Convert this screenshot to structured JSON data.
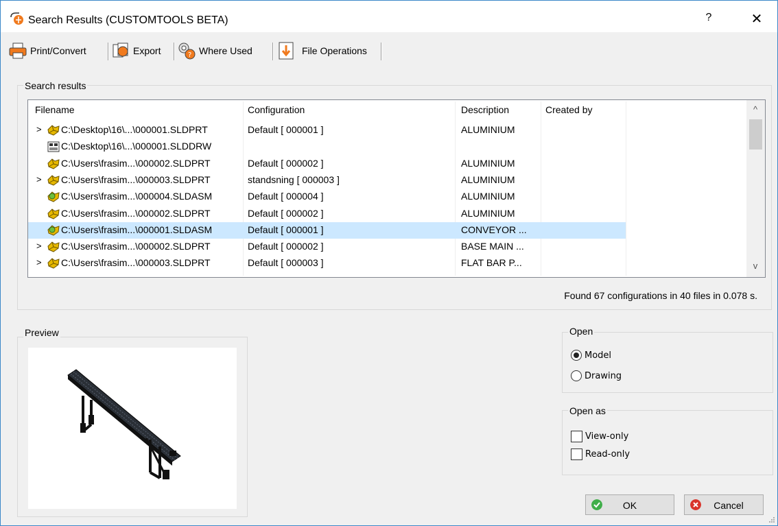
{
  "window": {
    "title": "Search Results (CUSTOMTOOLS BETA)",
    "help_label": "?",
    "close_label": "✕"
  },
  "toolbar": {
    "print_label": "Print/Convert",
    "export_label": "Export",
    "where_used_label": "Where Used",
    "file_ops_label": "File Operations"
  },
  "search": {
    "group_label": "Search results",
    "columns": [
      "Filename",
      "Configuration",
      "Description",
      "Created by"
    ],
    "rows": [
      {
        "expander": ">",
        "icon": "part-icon",
        "filename": "C:\\Desktop\\16\\...\\000001.SLDPRT",
        "configuration": "Default [ 000001 ]",
        "description": "ALUMINIUM",
        "created_by": ""
      },
      {
        "expander": "",
        "icon": "drawing-icon",
        "filename": "C:\\Desktop\\16\\...\\000001.SLDDRW",
        "configuration": "",
        "description": "",
        "created_by": ""
      },
      {
        "expander": "",
        "icon": "part-icon",
        "filename": "C:\\Users\\frasim...\\000002.SLDPRT",
        "configuration": "Default [ 000002 ]",
        "description": "ALUMINIUM",
        "created_by": ""
      },
      {
        "expander": ">",
        "icon": "part-icon",
        "filename": "C:\\Users\\frasim...\\000003.SLDPRT",
        "configuration": "standsning [ 000003 ]",
        "description": "ALUMINIUM",
        "created_by": ""
      },
      {
        "expander": "",
        "icon": "assembly-icon",
        "filename": "C:\\Users\\frasim...\\000004.SLDASM",
        "configuration": "Default [ 000004 ]",
        "description": "ALUMINIUM",
        "created_by": ""
      },
      {
        "expander": "",
        "icon": "part-icon",
        "filename": "C:\\Users\\frasim...\\000002.SLDPRT",
        "configuration": "Default [ 000002 ]",
        "description": "ALUMINIUM",
        "created_by": ""
      },
      {
        "expander": "",
        "icon": "assembly-icon",
        "filename": "C:\\Users\\frasim...\\000001.SLDASM",
        "configuration": "Default [ 000001 ]",
        "description": "CONVEYOR ...",
        "created_by": "",
        "selected": true
      },
      {
        "expander": ">",
        "icon": "part-icon",
        "filename": "C:\\Users\\frasim...\\000002.SLDPRT",
        "configuration": "Default [ 000002 ]",
        "description": "BASE MAIN ...",
        "created_by": ""
      },
      {
        "expander": ">",
        "icon": "part-icon",
        "filename": "C:\\Users\\frasim...\\000003.SLDPRT",
        "configuration": "Default [ 000003 ]",
        "description": "FLAT BAR P...",
        "created_by": ""
      }
    ],
    "status": "Found 67 configurations in 40 files in 0.078 s."
  },
  "preview": {
    "group_label": "Preview"
  },
  "open": {
    "group_label": "Open",
    "options": [
      "Model",
      "Drawing"
    ],
    "selected": "Model"
  },
  "open_as": {
    "group_label": "Open as",
    "options": [
      "View-only",
      "Read-only"
    ]
  },
  "buttons": {
    "ok_label": "OK",
    "cancel_label": "Cancel"
  },
  "colors": {
    "accent": "#3a87c8",
    "selection": "#cce8ff",
    "ok_green": "#3fae49",
    "cancel_red": "#d9342b"
  }
}
